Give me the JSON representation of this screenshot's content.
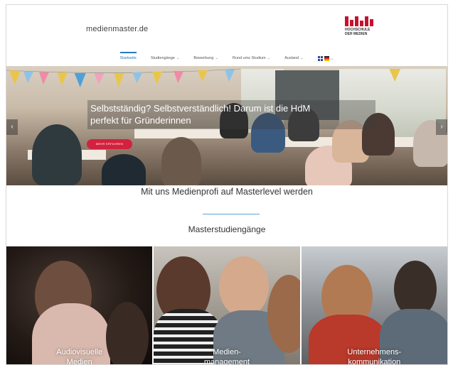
{
  "header": {
    "site_name": "medienmaster.de",
    "logo_text_line1": "HOCHSCHULE",
    "logo_text_line2": "DER MEDIEN"
  },
  "nav": {
    "items": [
      {
        "label": "Startseite",
        "active": true,
        "has_dropdown": false
      },
      {
        "label": "Studiengänge",
        "active": false,
        "has_dropdown": true
      },
      {
        "label": "Bewerbung",
        "active": false,
        "has_dropdown": true
      },
      {
        "label": "Rund ums Studium",
        "active": false,
        "has_dropdown": true
      },
      {
        "label": "Ausland",
        "active": false,
        "has_dropdown": true
      },
      {
        "label": "",
        "active": false,
        "has_dropdown": true,
        "icon": "flags-icon"
      }
    ]
  },
  "hero": {
    "caption_line1": "Selbstständig? Selbstverständlich! Darum ist die HdM",
    "caption_line2": "perfekt für Gründerinnen",
    "button_label": "MEHR ERFAHREN",
    "prev_arrow": "‹",
    "next_arrow": "›",
    "accent_color": "#d4213d"
  },
  "tagline": "Mit uns Medienprofi auf Masterlevel werden",
  "section_title": "Masterstudiengänge",
  "programs": [
    {
      "line1": "Audiovisuelle",
      "line2": "Medien"
    },
    {
      "line1": "Medien-",
      "line2": "management"
    },
    {
      "line1": "Unternehmens-",
      "line2": "kommunikation"
    }
  ],
  "colors": {
    "nav_active": "#2a7ab8",
    "divider": "#5aa4d6",
    "logo_red": "#c8102e"
  }
}
